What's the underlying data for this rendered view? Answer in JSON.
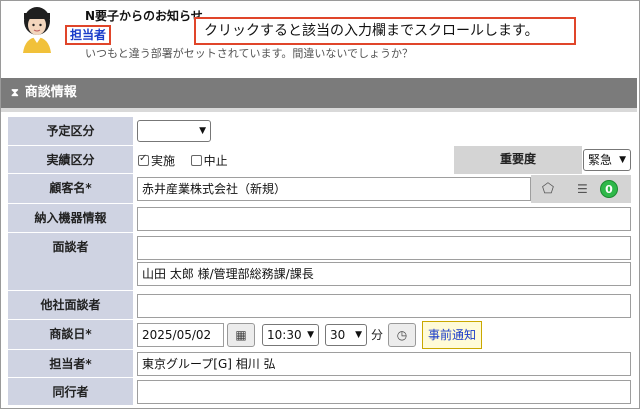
{
  "notice": {
    "title": "N要子からのお知らせ",
    "link_label": "担当者",
    "message": "いつもと違う部署がセットされています。間違いないでしょうか？",
    "callout": "クリックすると該当の入力欄までスクロールします。"
  },
  "section": {
    "icon": "collapse-icon",
    "title": "商談情報"
  },
  "form": {
    "yotei_kubun": {
      "label": "予定区分",
      "value": ""
    },
    "jisseki_kubun": {
      "label": "実績区分",
      "opt1": "実施",
      "opt1_checked": true,
      "opt2": "中止",
      "opt2_checked": false
    },
    "juyoudo": {
      "label": "重要度",
      "value": "緊急"
    },
    "kokyaku": {
      "label": "顧客名*",
      "value": "赤井産業株式会社（新規）",
      "badge": "0"
    },
    "nounyu": {
      "label": "納入機器情報",
      "value": ""
    },
    "mendansha": {
      "label": "面談者",
      "value1": "",
      "value2": "山田 太郎 様/管理部総務課/課長"
    },
    "tasha": {
      "label": "他社面談者",
      "value": ""
    },
    "shodanbi": {
      "label": "商談日*",
      "date": "2025/05/02",
      "hour": "10:30",
      "minute": "30",
      "minute_unit": "分",
      "notify_label": "事前通知"
    },
    "tantousha": {
      "label": "担当者*",
      "value": "東京グループ[G] 相川 弘"
    },
    "doukousha": {
      "label": "同行者",
      "value": ""
    }
  }
}
